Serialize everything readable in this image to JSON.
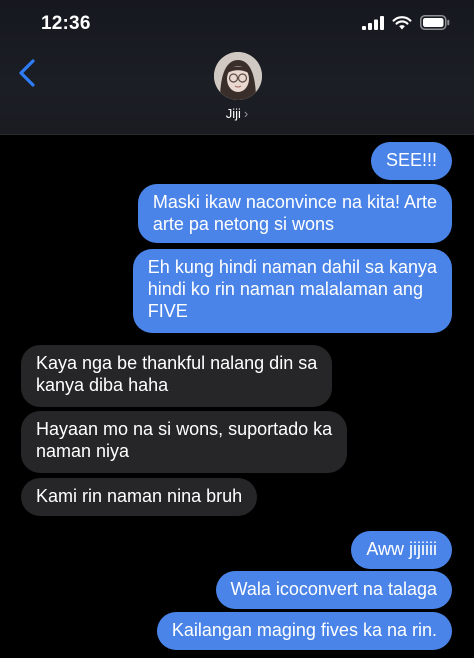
{
  "status": {
    "time": "12:36"
  },
  "contact": {
    "name": "Jiji",
    "chevron": "›"
  },
  "messages": [
    {
      "dir": "out",
      "text": "SEE!!!"
    },
    {
      "dir": "out",
      "text": "Maski ikaw naconvince na kita! Arte\narte pa netong si wons"
    },
    {
      "dir": "out",
      "text": "Eh kung hindi naman dahil sa kanya\nhindi ko rin naman malalaman ang\nFIVE"
    },
    {
      "dir": "in",
      "text": "Kaya nga be thankful nalang din sa\nkanya diba haha"
    },
    {
      "dir": "in",
      "text": "Hayaan mo na si wons, suportado ka\nnaman niya"
    },
    {
      "dir": "in",
      "text": "Kami rin naman nina bruh"
    },
    {
      "dir": "out",
      "text": "Aww jijiiii"
    },
    {
      "dir": "out",
      "text": "Wala icoconvert na talaga"
    },
    {
      "dir": "out",
      "text": "Kailangan maging fives ka na rin."
    }
  ],
  "colors": {
    "outgoing": "#4a84e8",
    "incoming": "#262628",
    "accent": "#3b82f6"
  }
}
